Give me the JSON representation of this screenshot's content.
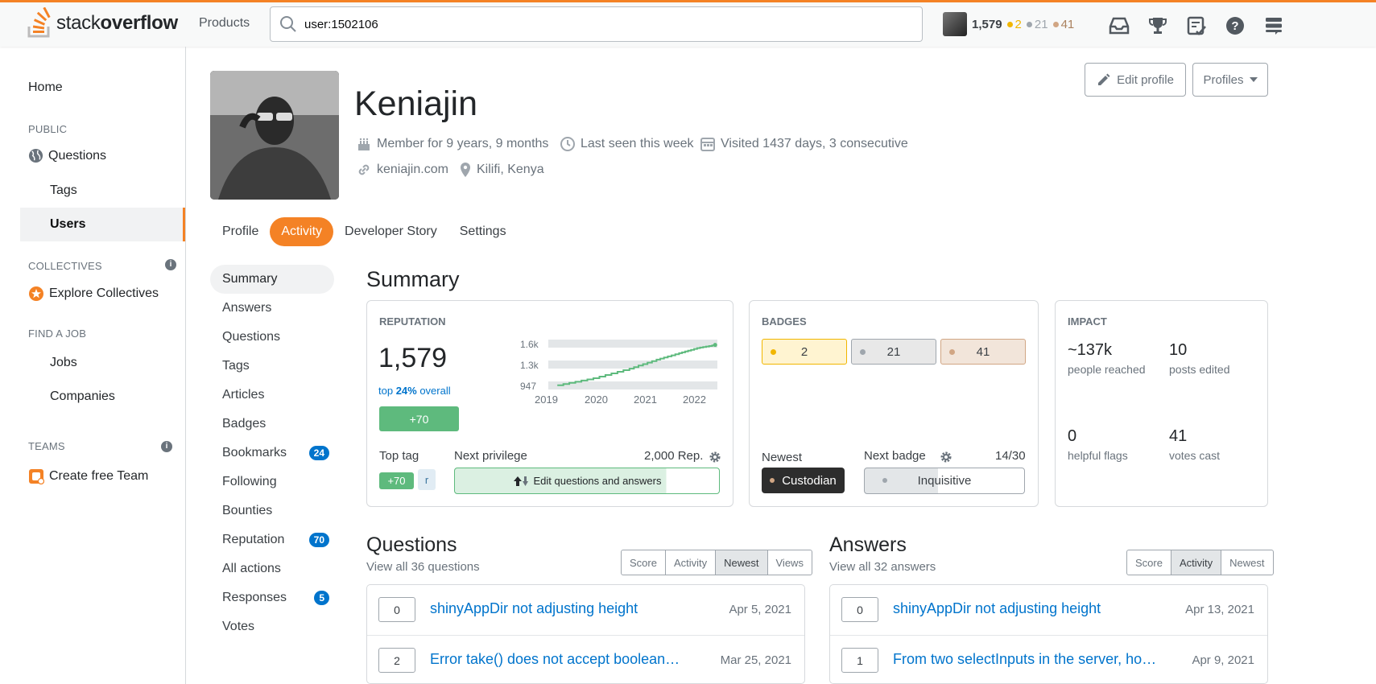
{
  "topbar": {
    "logo": {
      "light": "stack",
      "bold": "overflow"
    },
    "products_label": "Products",
    "search_value": "user:1502106",
    "reputation": "1,579",
    "gold": "2",
    "silver": "21",
    "bronze": "41",
    "icons": [
      "inbox-icon",
      "achievements-icon",
      "review-icon",
      "help-icon",
      "site-switcher-icon"
    ]
  },
  "leftnav": {
    "home": "Home",
    "public_heading": "PUBLIC",
    "questions": "Questions",
    "tags": "Tags",
    "users": "Users",
    "collectives_heading": "COLLECTIVES",
    "explore_collectives": "Explore Collectives",
    "job_heading": "FIND A JOB",
    "jobs": "Jobs",
    "companies": "Companies",
    "teams_heading": "TEAMS",
    "create_team": "Create free Team"
  },
  "profile": {
    "name": "Keniajin",
    "member_for": "Member for 9 years, 9 months",
    "last_seen": "Last seen this week",
    "visited": "Visited 1437 days, 3 consecutive",
    "website": "keniajin.com",
    "location": "Kilifi, Kenya",
    "edit_profile": "Edit profile",
    "profiles": "Profiles"
  },
  "tabs": [
    "Profile",
    "Activity",
    "Developer Story",
    "Settings"
  ],
  "subnav": [
    {
      "label": "Summary",
      "count": ""
    },
    {
      "label": "Answers",
      "count": ""
    },
    {
      "label": "Questions",
      "count": ""
    },
    {
      "label": "Tags",
      "count": ""
    },
    {
      "label": "Articles",
      "count": ""
    },
    {
      "label": "Badges",
      "count": ""
    },
    {
      "label": "Bookmarks",
      "count": "24"
    },
    {
      "label": "Following",
      "count": ""
    },
    {
      "label": "Bounties",
      "count": ""
    },
    {
      "label": "Reputation",
      "count": "70"
    },
    {
      "label": "All actions",
      "count": ""
    },
    {
      "label": "Responses",
      "count": "5"
    },
    {
      "label": "Votes",
      "count": ""
    }
  ],
  "summary": {
    "title": "Summary",
    "reputation": {
      "heading": "REPUTATION",
      "value": "1,579",
      "top_prefix": "top ",
      "top_pct": "24%",
      "top_suffix": " overall",
      "change": "+70",
      "top_tag_label": "Top tag",
      "top_tag_change": "+70",
      "top_tag": "r",
      "next_privilege_label": "Next privilege",
      "next_privilege_rep": "2,000 Rep.",
      "next_privilege": "Edit questions and answers",
      "next_privilege_progress": 0.79
    },
    "badges": {
      "heading": "BADGES",
      "gold": "2",
      "silver": "21",
      "bronze": "41",
      "newest_label": "Newest",
      "newest": "Custodian",
      "next_label": "Next badge",
      "next": "Inquisitive",
      "next_progress": "14/30"
    },
    "impact": {
      "heading": "IMPACT",
      "items": [
        {
          "value": "~137k",
          "label": "people reached"
        },
        {
          "value": "10",
          "label": "posts edited"
        },
        {
          "value": "0",
          "label": "helpful flags"
        },
        {
          "value": "41",
          "label": "votes cast"
        }
      ]
    }
  },
  "chart_data": {
    "type": "line",
    "x": [
      "2019",
      "2020",
      "2021",
      "2022"
    ],
    "ylim": [
      947,
      1600
    ],
    "ytick_labels": [
      "1.6k",
      "1.3k",
      "947"
    ],
    "xtick_labels": [
      "2019",
      "2020",
      "2021",
      "2022"
    ],
    "series": [
      {
        "values": [
          950,
          1060,
          1210,
          1350,
          1450,
          1530,
          1579
        ]
      }
    ],
    "series_x": [
      2019.0,
      2019.8,
      2020.6,
      2021.2,
      2021.7,
      2022.1,
      2022.5
    ],
    "grid": true,
    "color": "#5eba7d"
  },
  "questions": {
    "title": "Questions",
    "view_all": "View all 36 questions",
    "sort": [
      "Score",
      "Activity",
      "Newest",
      "Views"
    ],
    "active_sort": "Newest",
    "items": [
      {
        "score": "0",
        "title": "shinyAppDir not adjusting height",
        "date": "Apr 5, 2021"
      },
      {
        "score": "2",
        "title": "Error take() does not accept boolean…",
        "date": "Mar 25, 2021"
      }
    ]
  },
  "answers": {
    "title": "Answers",
    "view_all": "View all 32 answers",
    "sort": [
      "Score",
      "Activity",
      "Newest"
    ],
    "active_sort": "Activity",
    "items": [
      {
        "score": "0",
        "title": "shinyAppDir not adjusting height",
        "date": "Apr 13, 2021"
      },
      {
        "score": "1",
        "title": "From two selectInputs in the server, ho…",
        "date": "Apr 9, 2021"
      }
    ]
  }
}
